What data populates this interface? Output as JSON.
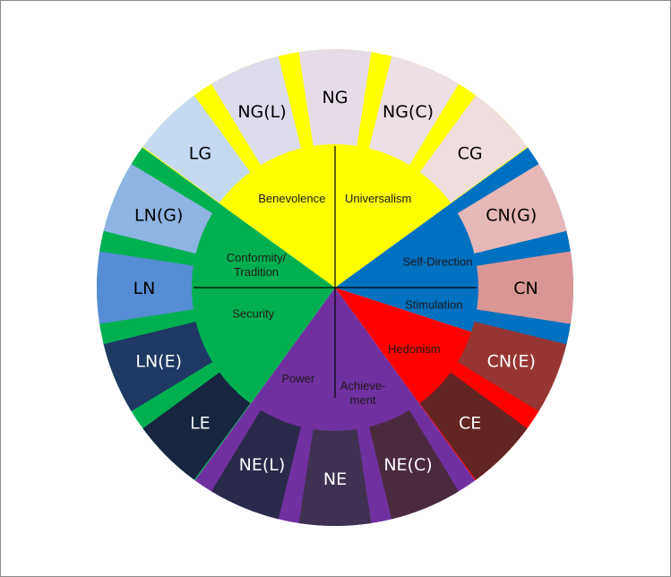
{
  "diagram": {
    "center_color": "#000000",
    "outer_segments": [
      {
        "label": "NG",
        "color": "#e6dce8",
        "text_color": "#000000"
      },
      {
        "label": "NG(C)",
        "color": "#ecdfe6",
        "text_color": "#000000"
      },
      {
        "label": "CG",
        "color": "#f0dddd",
        "text_color": "#000000"
      },
      {
        "label": "CN(G)",
        "color": "#e6b8b7",
        "text_color": "#000000"
      },
      {
        "label": "CN",
        "color": "#da9694",
        "text_color": "#000000"
      },
      {
        "label": "CN(E)",
        "color": "#963634",
        "text_color": "#ffffff"
      },
      {
        "label": "CE",
        "color": "#632523",
        "text_color": "#ffffff"
      },
      {
        "label": "NE(C)",
        "color": "#4a2a3e",
        "text_color": "#ffffff"
      },
      {
        "label": "NE",
        "color": "#3f3151",
        "text_color": "#ffffff"
      },
      {
        "label": "NE(L)",
        "color": "#2a2a4a",
        "text_color": "#ffffff"
      },
      {
        "label": "LE",
        "color": "#17253f",
        "text_color": "#ffffff"
      },
      {
        "label": "LN(E)",
        "color": "#1f3864",
        "text_color": "#ffffff"
      },
      {
        "label": "LN",
        "color": "#558ed5",
        "text_color": "#000000"
      },
      {
        "label": "LN(G)",
        "color": "#8eb4e3",
        "text_color": "#000000"
      },
      {
        "label": "LG",
        "color": "#c5d9f1",
        "text_color": "#000000"
      },
      {
        "label": "NG(L)",
        "color": "#dcdced",
        "text_color": "#000000"
      }
    ],
    "values": [
      {
        "label": "Benevolence",
        "color": "#ffff00"
      },
      {
        "label": "Universalism",
        "color": "#ffff00"
      },
      {
        "label": "Self-Direction",
        "color": "#0070c0"
      },
      {
        "label": "Stimulation",
        "color": "#0070c0"
      },
      {
        "label": "Hedonism",
        "color": "#ff0000"
      },
      {
        "label": "Achieve-",
        "label2": "ment",
        "color": "#7030a0"
      },
      {
        "label": "Power",
        "color": "#7030a0"
      },
      {
        "label": "Security",
        "color": "#00b050"
      },
      {
        "label": "Conformity/",
        "label2": "Tradition",
        "color": "#00b050"
      }
    ]
  }
}
